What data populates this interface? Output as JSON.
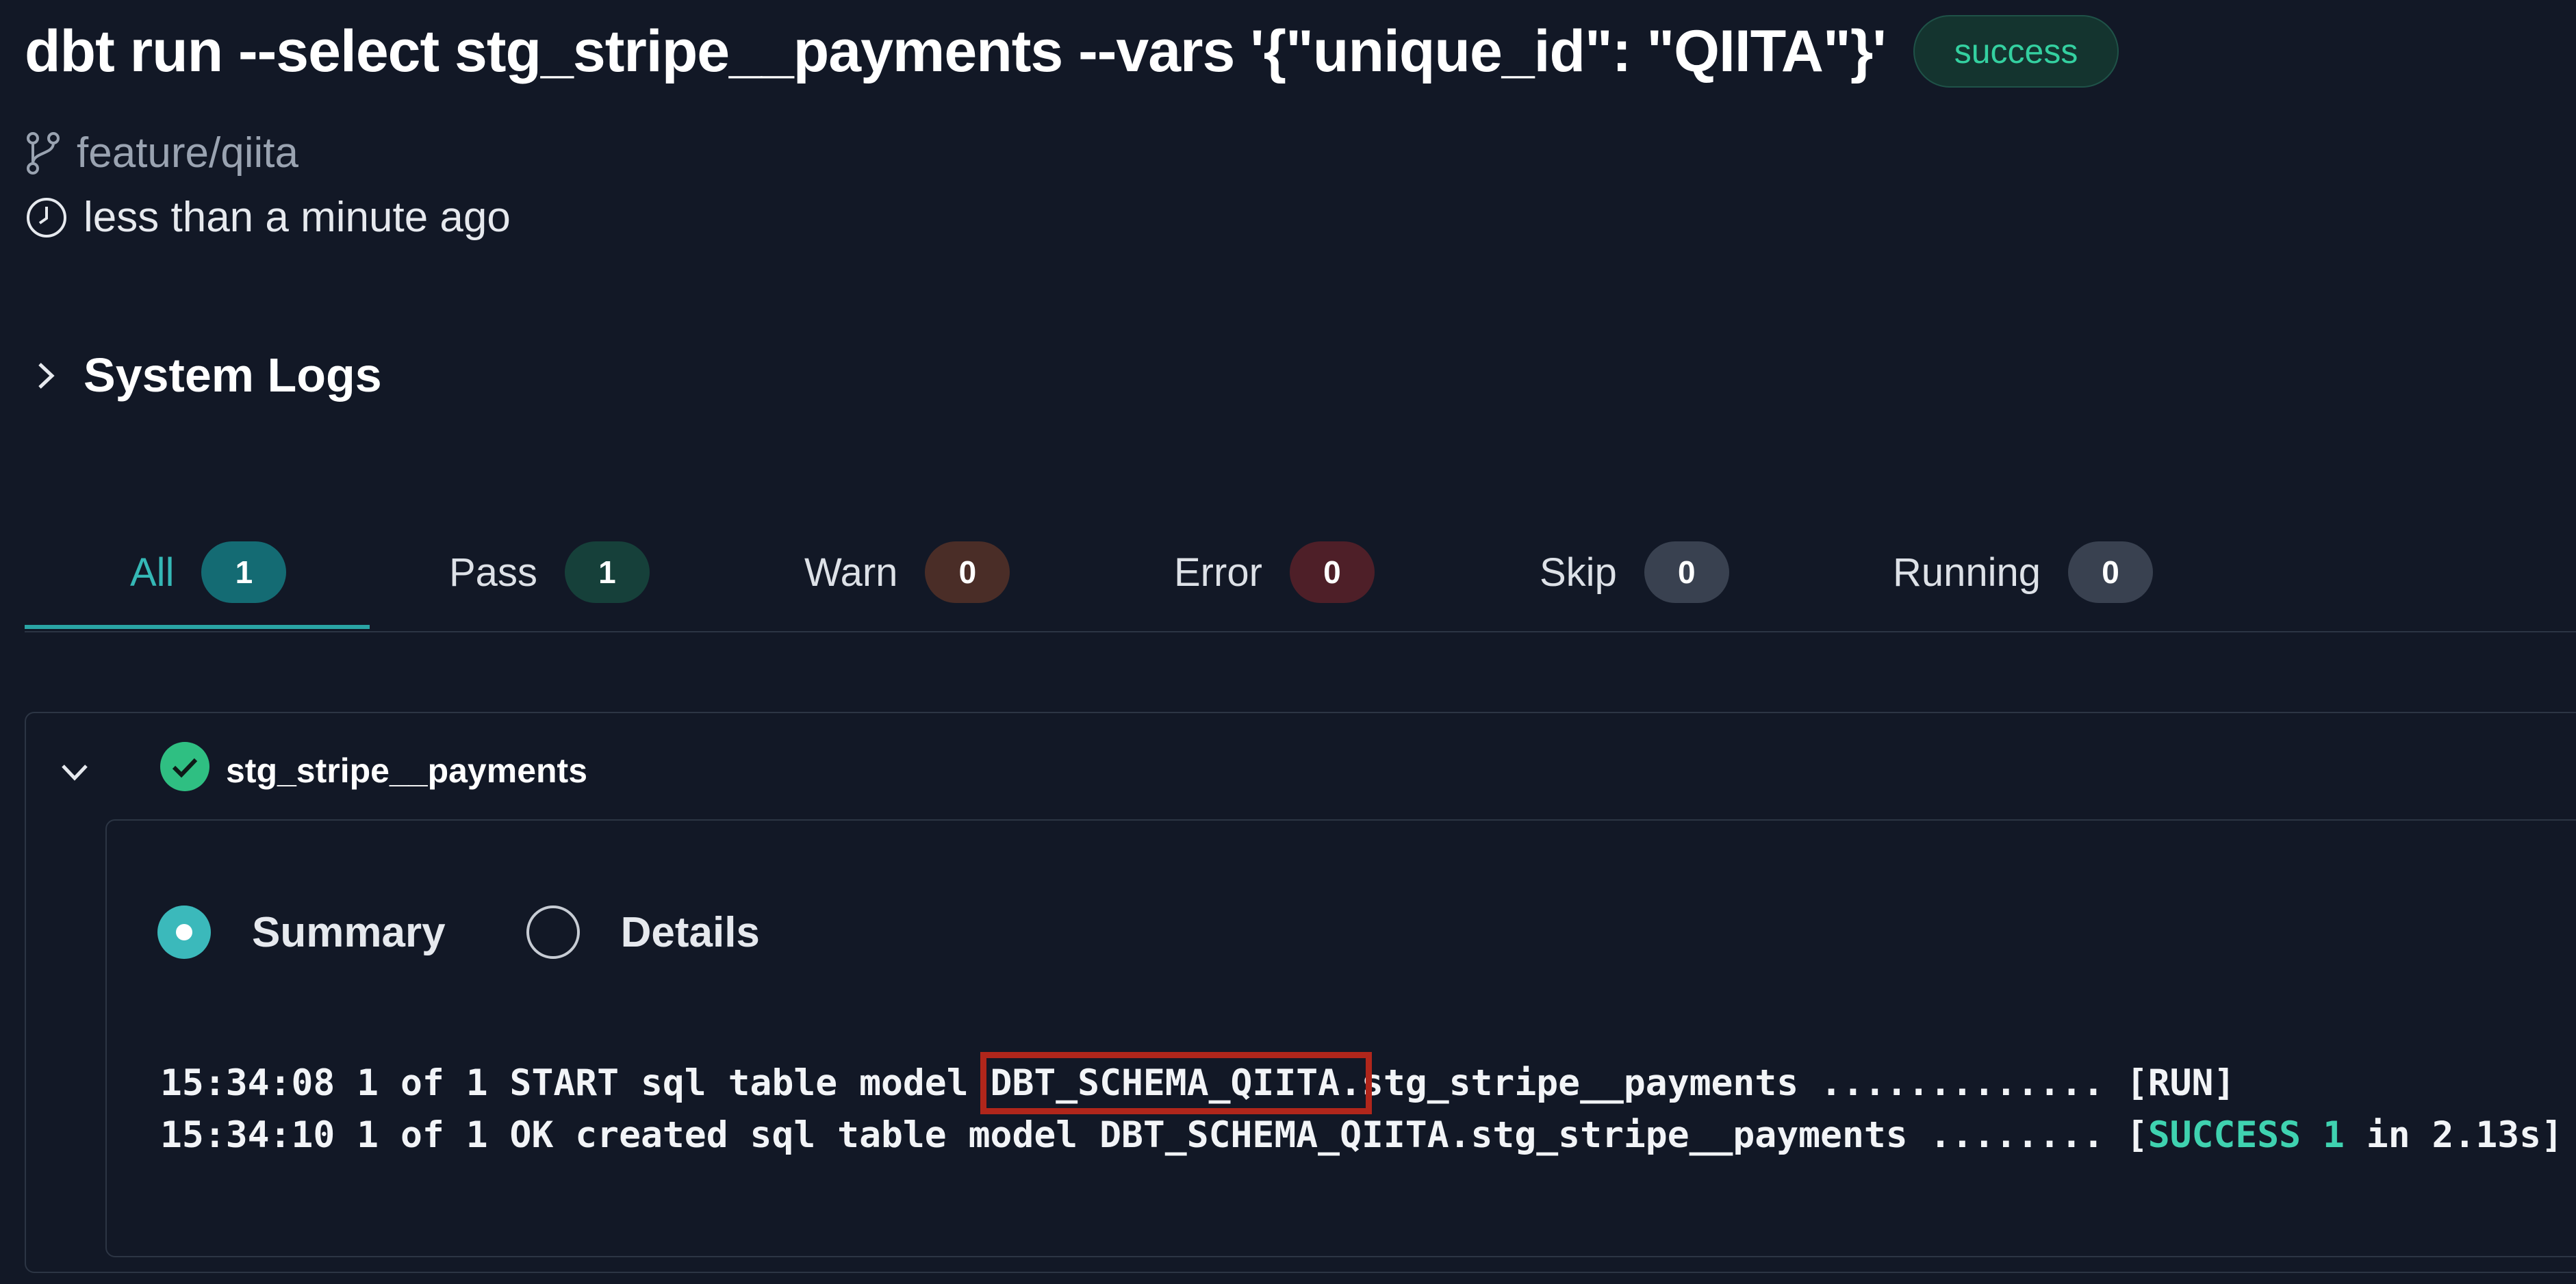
{
  "header": {
    "command": "dbt run --select stg_stripe__payments --vars '{\"unique_id\": \"QIITA\"}'",
    "status": "success"
  },
  "meta": {
    "branch": "feature/qiita",
    "time": "less than a minute ago"
  },
  "system_logs": {
    "label": "System Logs"
  },
  "tabs": [
    {
      "label": "All",
      "count": "1"
    },
    {
      "label": "Pass",
      "count": "1"
    },
    {
      "label": "Warn",
      "count": "0"
    },
    {
      "label": "Error",
      "count": "0"
    },
    {
      "label": "Skip",
      "count": "0"
    },
    {
      "label": "Running",
      "count": "0"
    }
  ],
  "model": {
    "name": "stg_stripe__payments",
    "view_options": {
      "summary": "Summary",
      "details": "Details",
      "selected": "Summary"
    },
    "log_lines": [
      {
        "prefix": "15:34:08 1 of 1 START sql table model ",
        "highlight": "DBT_SCHEMA_QIITA.",
        "suffix": "stg_stripe__payments ............. [RUN]"
      },
      {
        "prefix": "15:34:10 1 of 1 OK created sql table model DBT_SCHEMA_QIITA.stg_stripe__payments ........ [",
        "success": "SUCCESS 1",
        "suffix": " in 2.13s]"
      }
    ]
  },
  "colors": {
    "background": "#121826",
    "accent": "#35b8b6",
    "success": "#34d0a0",
    "highlight_box": "#b0261b"
  }
}
